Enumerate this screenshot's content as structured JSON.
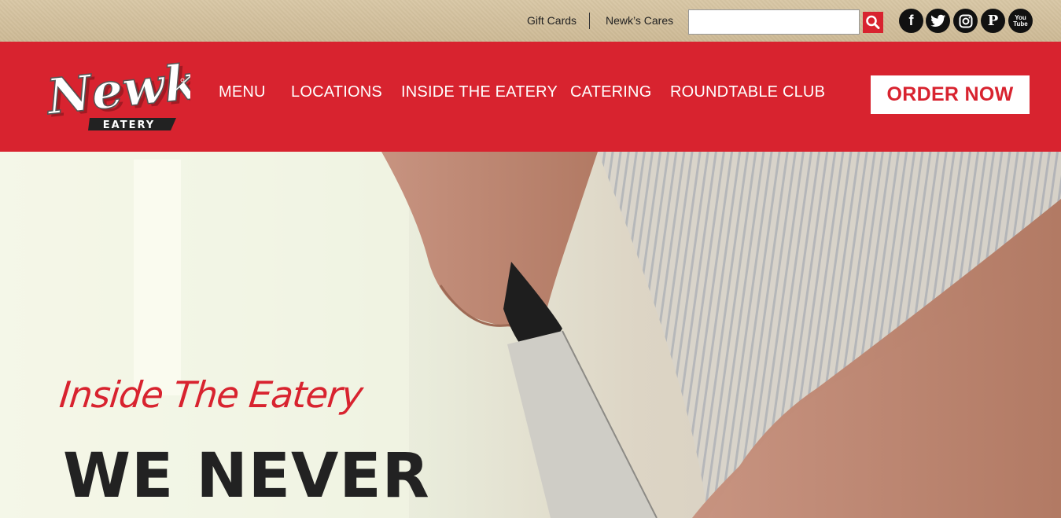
{
  "topbar": {
    "gift_cards": "Gift Cards",
    "newks_cares": "Newk’s Cares",
    "search_placeholder": "",
    "search_value": "",
    "social": {
      "facebook": "f",
      "pinterest": "P",
      "youtube_top": "You",
      "youtube_bottom": "Tube"
    }
  },
  "nav": {
    "logo_text": "Newk's",
    "logo_sub": "EATERY",
    "items": [
      {
        "label": "MENU"
      },
      {
        "label": "LOCATIONS"
      },
      {
        "label": "INSIDE THE EATERY"
      },
      {
        "label": "CATERING"
      },
      {
        "label": "ROUNDTABLE CLUB"
      }
    ],
    "order_now": "ORDER NOW"
  },
  "hero": {
    "script_title": "Inside The Eatery",
    "heading": "WE NEVER"
  },
  "colors": {
    "brand_red": "#d8232f",
    "topbar_tan": "#cdb995",
    "heading_dark": "#222222"
  }
}
